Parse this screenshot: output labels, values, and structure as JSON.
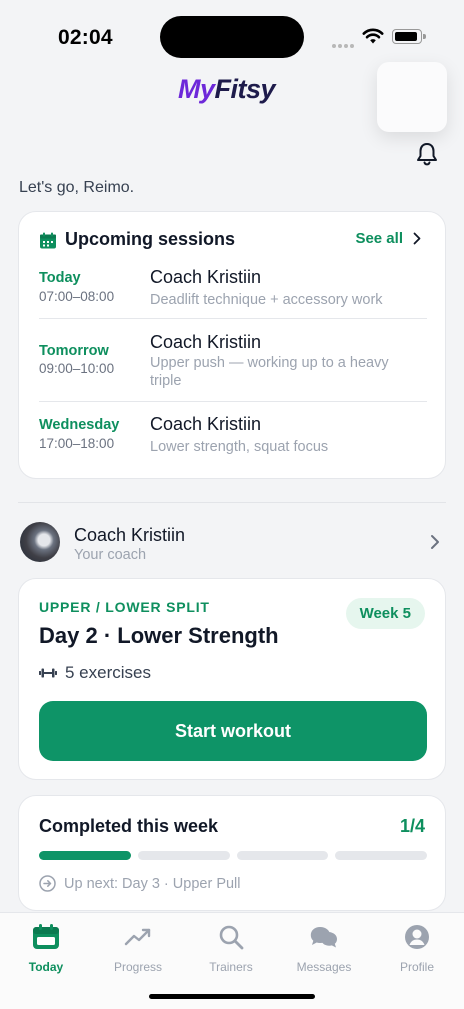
{
  "status_bar": {
    "time": "02:04"
  },
  "brand": {
    "name_part1": "My",
    "name_part2": "Fitsy"
  },
  "greeting": "Let's go, Reimo.",
  "upcoming": {
    "title": "Upcoming sessions",
    "see_all": "See all",
    "sessions": [
      {
        "day": "Today",
        "time": "07:00–08:00",
        "coach": "Coach Kristiin",
        "description": "Deadlift technique + accessory work"
      },
      {
        "day": "Tomorrow",
        "time": "09:00–10:00",
        "coach": "Coach Kristiin",
        "description": "Upper push — working up to a heavy triple"
      },
      {
        "day": "Wednesday",
        "time": "17:00–18:00",
        "coach": "Coach Kristiin",
        "description": "Lower strength, squat focus"
      }
    ]
  },
  "coach": {
    "name": "Coach Kristiin",
    "subtitle": "Your coach"
  },
  "workout": {
    "program": "UPPER / LOWER SPLIT",
    "week": "Week 5",
    "title": "Day 2 · Lower Strength",
    "exercises": "5 exercises",
    "start_label": "Start workout"
  },
  "completed": {
    "title": "Completed this week",
    "count": "1/4",
    "done": 1,
    "total": 4,
    "up_next": "Up next: Day 3 · Upper Pull"
  },
  "tabs": [
    {
      "label": "Today",
      "icon": "calendar-icon",
      "active": true
    },
    {
      "label": "Progress",
      "icon": "trend-icon",
      "active": false
    },
    {
      "label": "Trainers",
      "icon": "search-icon",
      "active": false
    },
    {
      "label": "Messages",
      "icon": "chat-icon",
      "active": false
    },
    {
      "label": "Profile",
      "icon": "person-icon",
      "active": false
    }
  ],
  "colors": {
    "accent": "#0e9467",
    "brand": "#6d28d9"
  }
}
